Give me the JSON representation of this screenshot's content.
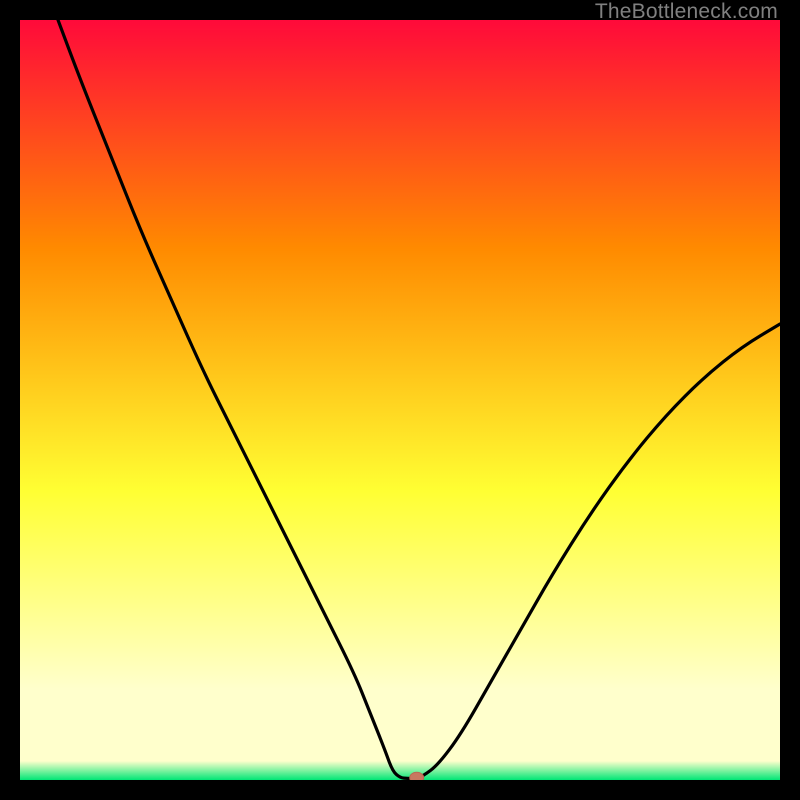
{
  "attribution": "TheBottleneck.com",
  "colors": {
    "frame": "#000000",
    "gradient_top": "#ff0a3a",
    "gradient_mid1": "#ff8a00",
    "gradient_mid2": "#ffff33",
    "gradient_pale": "#ffffcc",
    "gradient_bottom": "#00e676",
    "curve": "#000000",
    "marker_fill": "#c87860",
    "marker_stroke": "#b86a54"
  },
  "chart_data": {
    "type": "line",
    "title": "",
    "xlabel": "",
    "ylabel": "",
    "xlim": [
      0,
      100
    ],
    "ylim": [
      0,
      100
    ],
    "notes": "Bottleneck-style curve: steep descending branch from top-left, flat minimum near x≈51, rising branch to right edge reaching y≈60. Background is a vertical red→orange→yellow→pale-yellow→green gradient. A single salmon-colored marker sits at the curve minimum.",
    "series": [
      {
        "name": "curve",
        "x": [
          5,
          8,
          12,
          16,
          20,
          24,
          28,
          32,
          36,
          40,
          44,
          46,
          48,
          49,
          50,
          51,
          52,
          53,
          55,
          58,
          62,
          66,
          70,
          75,
          80,
          85,
          90,
          95,
          100
        ],
        "y": [
          100,
          92,
          82,
          72,
          63,
          54,
          46,
          38,
          30,
          22,
          14,
          9,
          4,
          1.2,
          0.3,
          0.2,
          0.2,
          0.5,
          2,
          6,
          13,
          20,
          27,
          35,
          42,
          48,
          53,
          57,
          60
        ]
      }
    ],
    "marker": {
      "x": 52.2,
      "y": 0.3
    },
    "gradient_stops": [
      {
        "offset": 0,
        "key": "gradient_top"
      },
      {
        "offset": 0.3,
        "key": "gradient_mid1"
      },
      {
        "offset": 0.62,
        "key": "gradient_mid2"
      },
      {
        "offset": 0.88,
        "key": "gradient_pale"
      },
      {
        "offset": 0.975,
        "key": "gradient_pale"
      },
      {
        "offset": 1.0,
        "key": "gradient_bottom"
      }
    ]
  }
}
